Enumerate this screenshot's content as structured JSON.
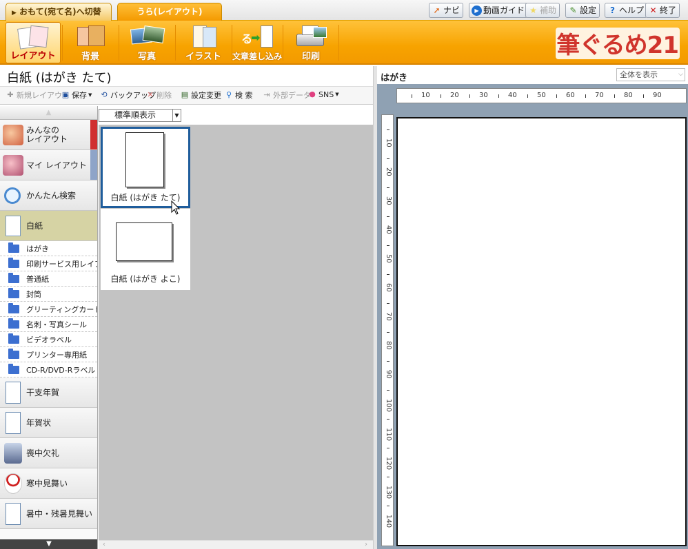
{
  "topbar": {
    "tab_front": "おもて(宛て名)へ切替",
    "tab_back": "うら(レイアウト)",
    "buttons": [
      {
        "label": "ナビ",
        "icon": "navi-arrow-icon",
        "color": "#e05a00",
        "disabled": false
      },
      {
        "label": "動画ガイド",
        "icon": "play-icon",
        "color": "#1e6fcf",
        "disabled": false
      },
      {
        "label": "補助",
        "icon": "star-icon",
        "color": "#e8c200",
        "disabled": true
      },
      {
        "label": "設定",
        "icon": "wrench-icon",
        "color": "#4a8f2e",
        "disabled": false
      },
      {
        "label": "ヘルプ",
        "icon": "help-icon",
        "color": "#1e6fcf",
        "disabled": false
      },
      {
        "label": "終了",
        "icon": "close-icon",
        "color": "#d02020",
        "disabled": false
      }
    ]
  },
  "ribbon": {
    "items": [
      {
        "label": "レイアウト",
        "icon": "layout-icon",
        "active": true
      },
      {
        "label": "背景",
        "icon": "background-icon",
        "active": false
      },
      {
        "label": "写真",
        "icon": "photo-icon",
        "active": false
      },
      {
        "label": "イラスト",
        "icon": "illustration-icon",
        "active": false
      },
      {
        "label": "文章差し込み",
        "icon": "text-insert-icon",
        "active": false
      },
      {
        "label": "印刷",
        "icon": "printer-icon",
        "active": false
      }
    ],
    "brand": "筆ぐるめ21"
  },
  "left_panel": {
    "title": "白紙 (はがき たて)",
    "toolbar": [
      {
        "label": "新規レイアウト",
        "icon": "new-layout-icon",
        "disabled": true
      },
      {
        "label": "保存",
        "icon": "save-icon",
        "disabled": false,
        "dropdown": true
      },
      {
        "label": "バックアップ",
        "icon": "backup-icon",
        "disabled": false
      },
      {
        "label": "削除",
        "icon": "delete-icon",
        "disabled": true
      },
      {
        "label": "設定変更",
        "icon": "settings-change-icon",
        "disabled": false
      },
      {
        "label": "検 索",
        "icon": "search-icon",
        "disabled": false
      },
      {
        "label": "外部データ",
        "icon": "external-data-icon",
        "disabled": true
      },
      {
        "label": "SNS",
        "icon": "sns-icon",
        "disabled": false,
        "dropdown": true
      }
    ],
    "sort": {
      "value": "標準順表示"
    }
  },
  "sidebar": {
    "categories_top": [
      {
        "label": "みんなの\nレイアウト",
        "icon": "people-icon",
        "edge": "#d03030"
      },
      {
        "label": "マイ レイアウト",
        "icon": "my-layout-icon",
        "edge": "#8ea4c8"
      },
      {
        "label": "かんたん検索",
        "icon": "magnifier-icon",
        "edge": ""
      },
      {
        "label": "白紙",
        "icon": "blank-paper-icon",
        "edge": "",
        "selected": true
      }
    ],
    "subfolders": [
      "はがき",
      "印刷サービス用レイアウト",
      "普通紙",
      "封筒",
      "グリーティングカード",
      "名刺・写真シール",
      "ビデオラベル",
      "プリンター専用紙",
      "CD-R/DVD-Rラベル"
    ],
    "categories_bottom": [
      {
        "label": "干支年賀",
        "icon": "postcard-icon"
      },
      {
        "label": "年賀状",
        "icon": "postcard-icon"
      },
      {
        "label": "喪中欠礼",
        "icon": "mourning-icon"
      },
      {
        "label": "寒中見舞い",
        "icon": "snowman-icon"
      },
      {
        "label": "暑中・残暑見舞い",
        "icon": "postcard-icon"
      }
    ]
  },
  "templates": [
    {
      "caption": "白紙 (はがき たて)",
      "orientation": "portrait",
      "selected": true
    },
    {
      "caption": "白紙 (はがき よこ)",
      "orientation": "landscape",
      "selected": false
    }
  ],
  "right_panel": {
    "title": "はがき",
    "zoom": "全体を表示",
    "ruler_top": [
      "10",
      "20",
      "30",
      "40",
      "50",
      "60",
      "70",
      "80",
      "90"
    ],
    "ruler_left": [
      "10",
      "20",
      "30",
      "40",
      "50",
      "60",
      "70",
      "80",
      "90",
      "100",
      "110",
      "120",
      "130",
      "140"
    ]
  }
}
